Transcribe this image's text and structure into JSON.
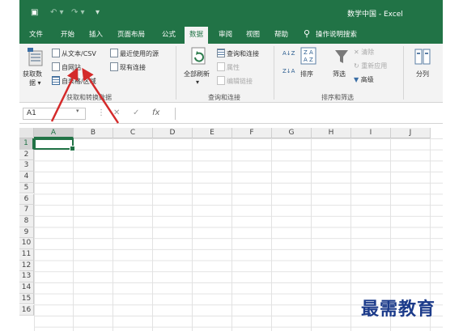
{
  "window": {
    "title": "数学中国 - Excel",
    "quick_access": {
      "save_glyph": "▣",
      "undo_glyph": "↶ ▾",
      "redo_glyph": "↷ ▾",
      "customize_glyph": "▾"
    },
    "accent_color": "#217346"
  },
  "tabs": [
    {
      "label": "文件"
    },
    {
      "label": "开始"
    },
    {
      "label": "插入"
    },
    {
      "label": "页面布局"
    },
    {
      "label": "公式"
    },
    {
      "label": "数据",
      "active": true
    },
    {
      "label": "审阅"
    },
    {
      "label": "视图"
    },
    {
      "label": "帮助"
    }
  ],
  "tell_me": {
    "icon": "lightbulb-icon",
    "label": "操作说明搜索"
  },
  "ribbon": {
    "get_transform": {
      "get_data_label_line1": "获取数",
      "get_data_label_line2": "据 ▾",
      "from_text_csv": "从文本/CSV",
      "from_web": "自网站",
      "from_table_range": "自表格/区域",
      "recent_sources": "最近使用的源",
      "existing_connections": "现有连接",
      "group_label": "获取和转换数据"
    },
    "queries": {
      "refresh_all_line1": "全部刷新",
      "refresh_all_line2": "▾",
      "queries_connections": "查询和连接",
      "properties": "属性",
      "edit_links": "编辑链接",
      "group_label": "查询和连接"
    },
    "sort_filter": {
      "sort_az": "A↓Z",
      "sort_za": "Z↓A",
      "sort": "排序",
      "filter": "筛选",
      "clear": "清除",
      "reapply": "重新应用",
      "advanced": "高级",
      "group_label": "排序和筛选"
    },
    "data_tools": {
      "split_column": "分列"
    }
  },
  "formula_bar": {
    "name_box": "A1",
    "name_box_arrow": "▾",
    "divider": "⋮",
    "cancel": "✕",
    "enter": "✓",
    "fx": "fx",
    "formula": ""
  },
  "grid": {
    "columns": [
      "A",
      "B",
      "C",
      "D",
      "E",
      "F",
      "G",
      "H",
      "I",
      "J"
    ],
    "rows": [
      "1",
      "2",
      "3",
      "4",
      "5",
      "6",
      "7",
      "8",
      "9",
      "10",
      "11",
      "12",
      "13",
      "14",
      "15",
      "16"
    ],
    "active_cell": "A1"
  },
  "watermark": "最需教育",
  "annotation_color": "#d42a2a"
}
